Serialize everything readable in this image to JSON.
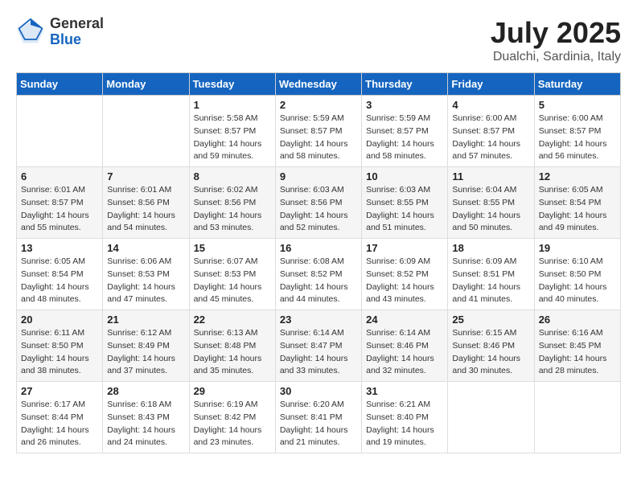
{
  "header": {
    "logo_general": "General",
    "logo_blue": "Blue",
    "title": "July 2025",
    "subtitle": "Dualchi, Sardinia, Italy"
  },
  "weekdays": [
    "Sunday",
    "Monday",
    "Tuesday",
    "Wednesday",
    "Thursday",
    "Friday",
    "Saturday"
  ],
  "weeks": [
    [
      {
        "day": "",
        "sunrise": "",
        "sunset": "",
        "daylight": ""
      },
      {
        "day": "",
        "sunrise": "",
        "sunset": "",
        "daylight": ""
      },
      {
        "day": "1",
        "sunrise": "Sunrise: 5:58 AM",
        "sunset": "Sunset: 8:57 PM",
        "daylight": "Daylight: 14 hours and 59 minutes."
      },
      {
        "day": "2",
        "sunrise": "Sunrise: 5:59 AM",
        "sunset": "Sunset: 8:57 PM",
        "daylight": "Daylight: 14 hours and 58 minutes."
      },
      {
        "day": "3",
        "sunrise": "Sunrise: 5:59 AM",
        "sunset": "Sunset: 8:57 PM",
        "daylight": "Daylight: 14 hours and 58 minutes."
      },
      {
        "day": "4",
        "sunrise": "Sunrise: 6:00 AM",
        "sunset": "Sunset: 8:57 PM",
        "daylight": "Daylight: 14 hours and 57 minutes."
      },
      {
        "day": "5",
        "sunrise": "Sunrise: 6:00 AM",
        "sunset": "Sunset: 8:57 PM",
        "daylight": "Daylight: 14 hours and 56 minutes."
      }
    ],
    [
      {
        "day": "6",
        "sunrise": "Sunrise: 6:01 AM",
        "sunset": "Sunset: 8:57 PM",
        "daylight": "Daylight: 14 hours and 55 minutes."
      },
      {
        "day": "7",
        "sunrise": "Sunrise: 6:01 AM",
        "sunset": "Sunset: 8:56 PM",
        "daylight": "Daylight: 14 hours and 54 minutes."
      },
      {
        "day": "8",
        "sunrise": "Sunrise: 6:02 AM",
        "sunset": "Sunset: 8:56 PM",
        "daylight": "Daylight: 14 hours and 53 minutes."
      },
      {
        "day": "9",
        "sunrise": "Sunrise: 6:03 AM",
        "sunset": "Sunset: 8:56 PM",
        "daylight": "Daylight: 14 hours and 52 minutes."
      },
      {
        "day": "10",
        "sunrise": "Sunrise: 6:03 AM",
        "sunset": "Sunset: 8:55 PM",
        "daylight": "Daylight: 14 hours and 51 minutes."
      },
      {
        "day": "11",
        "sunrise": "Sunrise: 6:04 AM",
        "sunset": "Sunset: 8:55 PM",
        "daylight": "Daylight: 14 hours and 50 minutes."
      },
      {
        "day": "12",
        "sunrise": "Sunrise: 6:05 AM",
        "sunset": "Sunset: 8:54 PM",
        "daylight": "Daylight: 14 hours and 49 minutes."
      }
    ],
    [
      {
        "day": "13",
        "sunrise": "Sunrise: 6:05 AM",
        "sunset": "Sunset: 8:54 PM",
        "daylight": "Daylight: 14 hours and 48 minutes."
      },
      {
        "day": "14",
        "sunrise": "Sunrise: 6:06 AM",
        "sunset": "Sunset: 8:53 PM",
        "daylight": "Daylight: 14 hours and 47 minutes."
      },
      {
        "day": "15",
        "sunrise": "Sunrise: 6:07 AM",
        "sunset": "Sunset: 8:53 PM",
        "daylight": "Daylight: 14 hours and 45 minutes."
      },
      {
        "day": "16",
        "sunrise": "Sunrise: 6:08 AM",
        "sunset": "Sunset: 8:52 PM",
        "daylight": "Daylight: 14 hours and 44 minutes."
      },
      {
        "day": "17",
        "sunrise": "Sunrise: 6:09 AM",
        "sunset": "Sunset: 8:52 PM",
        "daylight": "Daylight: 14 hours and 43 minutes."
      },
      {
        "day": "18",
        "sunrise": "Sunrise: 6:09 AM",
        "sunset": "Sunset: 8:51 PM",
        "daylight": "Daylight: 14 hours and 41 minutes."
      },
      {
        "day": "19",
        "sunrise": "Sunrise: 6:10 AM",
        "sunset": "Sunset: 8:50 PM",
        "daylight": "Daylight: 14 hours and 40 minutes."
      }
    ],
    [
      {
        "day": "20",
        "sunrise": "Sunrise: 6:11 AM",
        "sunset": "Sunset: 8:50 PM",
        "daylight": "Daylight: 14 hours and 38 minutes."
      },
      {
        "day": "21",
        "sunrise": "Sunrise: 6:12 AM",
        "sunset": "Sunset: 8:49 PM",
        "daylight": "Daylight: 14 hours and 37 minutes."
      },
      {
        "day": "22",
        "sunrise": "Sunrise: 6:13 AM",
        "sunset": "Sunset: 8:48 PM",
        "daylight": "Daylight: 14 hours and 35 minutes."
      },
      {
        "day": "23",
        "sunrise": "Sunrise: 6:14 AM",
        "sunset": "Sunset: 8:47 PM",
        "daylight": "Daylight: 14 hours and 33 minutes."
      },
      {
        "day": "24",
        "sunrise": "Sunrise: 6:14 AM",
        "sunset": "Sunset: 8:46 PM",
        "daylight": "Daylight: 14 hours and 32 minutes."
      },
      {
        "day": "25",
        "sunrise": "Sunrise: 6:15 AM",
        "sunset": "Sunset: 8:46 PM",
        "daylight": "Daylight: 14 hours and 30 minutes."
      },
      {
        "day": "26",
        "sunrise": "Sunrise: 6:16 AM",
        "sunset": "Sunset: 8:45 PM",
        "daylight": "Daylight: 14 hours and 28 minutes."
      }
    ],
    [
      {
        "day": "27",
        "sunrise": "Sunrise: 6:17 AM",
        "sunset": "Sunset: 8:44 PM",
        "daylight": "Daylight: 14 hours and 26 minutes."
      },
      {
        "day": "28",
        "sunrise": "Sunrise: 6:18 AM",
        "sunset": "Sunset: 8:43 PM",
        "daylight": "Daylight: 14 hours and 24 minutes."
      },
      {
        "day": "29",
        "sunrise": "Sunrise: 6:19 AM",
        "sunset": "Sunset: 8:42 PM",
        "daylight": "Daylight: 14 hours and 23 minutes."
      },
      {
        "day": "30",
        "sunrise": "Sunrise: 6:20 AM",
        "sunset": "Sunset: 8:41 PM",
        "daylight": "Daylight: 14 hours and 21 minutes."
      },
      {
        "day": "31",
        "sunrise": "Sunrise: 6:21 AM",
        "sunset": "Sunset: 8:40 PM",
        "daylight": "Daylight: 14 hours and 19 minutes."
      },
      {
        "day": "",
        "sunrise": "",
        "sunset": "",
        "daylight": ""
      },
      {
        "day": "",
        "sunrise": "",
        "sunset": "",
        "daylight": ""
      }
    ]
  ]
}
